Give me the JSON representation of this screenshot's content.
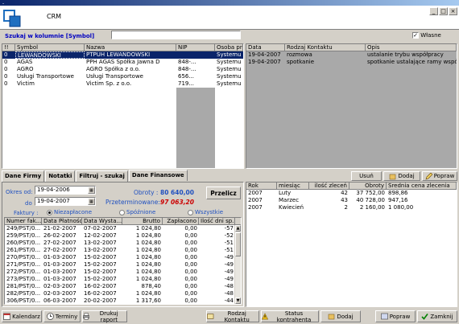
{
  "window": {
    "title": "-",
    "app_title": "CRM",
    "minimize": "_",
    "maximize": "□",
    "close": "×"
  },
  "search": {
    "label": "Szukaj w kolumnie [Symbol]",
    "value": ""
  },
  "own_checkbox": {
    "label": "Własne",
    "checked": true
  },
  "clients": {
    "columns": [
      "!!",
      "Symbol",
      "Nazwa",
      "NIP",
      "Osoba pr"
    ],
    "rows": [
      [
        "0",
        "LEWANDOWSKI",
        "PTPUH  LEWANDOWSKI",
        "",
        "Systemu"
      ],
      [
        "0",
        "AGAS",
        "PPH AGAS Spółka Jawna  D",
        "848-...",
        "Systemu"
      ],
      [
        "0",
        "AGRO",
        "AGRO Spółka z o.o.",
        "848-...",
        "Systemu"
      ],
      [
        "0",
        "Usługi Transportowe",
        "Usługi Transportowe",
        "656...",
        "Systemu"
      ],
      [
        "0",
        "Victim",
        "Victim Sp. z o.o.",
        "719...",
        "Systemu"
      ]
    ]
  },
  "contacts": {
    "columns": [
      "Data",
      "Rodzaj Kontaktu",
      "Opis"
    ],
    "rows": [
      [
        "19-04-2007",
        "rozmowa",
        "ustalanie trybu współpracy"
      ],
      [
        "19-04-2007",
        "spotkanie",
        "spotkanie ustalające ramy współpracy"
      ]
    ]
  },
  "tabs": [
    "Dane Firmy",
    "Notatki",
    "Filtruj - szukaj",
    "Dane Finansowe"
  ],
  "finance": {
    "from_label": "Okres od:",
    "from_date": "19-04-2006",
    "to_label": "do",
    "to_date": "19-04-2007",
    "turnover_label": "Obroty :",
    "turnover_value": "80 640,00",
    "overdue_label": "Przeterminowane:",
    "overdue_value": "97 063,20",
    "recalc_button": "Przelicz",
    "invoices_label": "Faktury :",
    "radio": [
      "Niezapłacone",
      "Spóźnione",
      "Wszystkie"
    ],
    "radio_selected": 0,
    "columns": [
      "Numer fak...",
      "Data Płatności",
      "Data Wysta...",
      "Brutto",
      "Zapłacono",
      "Ilość dni sp."
    ],
    "rows": [
      [
        "249/PST/0...",
        "21-02-2007",
        "07-02-2007",
        "1 024,80",
        "0,00",
        "-57"
      ],
      [
        "259/PST/0...",
        "26-02-2007",
        "12-02-2007",
        "1 024,80",
        "0,00",
        "-52"
      ],
      [
        "260/PST/0...",
        "27-02-2007",
        "13-02-2007",
        "1 024,80",
        "0,00",
        "-51"
      ],
      [
        "261/PST/0...",
        "27-02-2007",
        "13-02-2007",
        "1 024,80",
        "0,00",
        "-51"
      ],
      [
        "270/PST/0...",
        "01-03-2007",
        "15-02-2007",
        "1 024,80",
        "0,00",
        "-49"
      ],
      [
        "271/PST/0...",
        "01-03-2007",
        "15-02-2007",
        "1 024,80",
        "0,00",
        "-49"
      ],
      [
        "272/PST/0...",
        "01-03-2007",
        "15-02-2007",
        "1 024,80",
        "0,00",
        "-49"
      ],
      [
        "273/PST/0...",
        "01-03-2007",
        "15-02-2007",
        "1 024,80",
        "0,00",
        "-49"
      ],
      [
        "281/PST/0...",
        "02-03-2007",
        "16-02-2007",
        "878,40",
        "0,00",
        "-48"
      ],
      [
        "282/PST/0...",
        "02-03-2007",
        "16-02-2007",
        "1 024,80",
        "0,00",
        "-48"
      ],
      [
        "306/PST/0...",
        "06-03-2007",
        "20-02-2007",
        "1 317,60",
        "0,00",
        "-44"
      ]
    ]
  },
  "summary_buttons": {
    "delete": "Usuń",
    "add": "Dodaj",
    "fix": "Popraw"
  },
  "monthly": {
    "columns": [
      "Rok",
      "miesiąc",
      "ilość zleceń",
      "Obroty",
      "Średnia cena zlecenia"
    ],
    "rows": [
      [
        "2007",
        "Luty",
        "42",
        "37 752,00",
        "898,86"
      ],
      [
        "2007",
        "Marzec",
        "43",
        "40 728,00",
        "947,16"
      ],
      [
        "2007",
        "Kwiecień",
        "2",
        "2 160,00",
        "1 080,00"
      ]
    ]
  },
  "bottom_buttons": {
    "calendar": "Kalendarz",
    "terms": "Terminy",
    "print": "Drukuj raport",
    "contact_type": "Rodzaj Kontaktu",
    "client_status": "Status kontrahenta",
    "add": "Dodaj",
    "fix": "Popraw",
    "close": "Zamknij"
  }
}
